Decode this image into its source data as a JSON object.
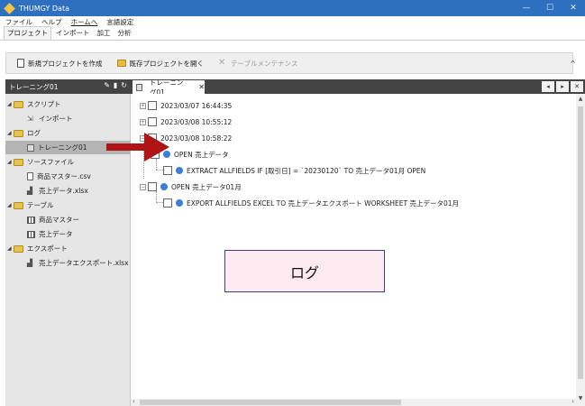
{
  "window": {
    "title": "THUMGY Data",
    "controls": [
      "—",
      "☐",
      "✕"
    ]
  },
  "menu": [
    "ファイル",
    "ヘルプ",
    "ホームへ",
    "言語設定"
  ],
  "ribbon_tabs": [
    "プロジェクト",
    "インポート",
    "加工",
    "分析"
  ],
  "toolbar": {
    "new_project": "新規プロジェクトを作成",
    "open_project": "既存プロジェクトを開く",
    "table_maint": "テーブルメンテナンス"
  },
  "left_panel": {
    "title": "トレーニング01",
    "items": [
      {
        "label": "スクリプト"
      },
      {
        "label": "インポート"
      },
      {
        "label": "ログ"
      },
      {
        "label": "トレーニング01"
      },
      {
        "label": "ソースファイル"
      },
      {
        "label": "商品マスター.csv"
      },
      {
        "label": "売上データ.xlsx"
      },
      {
        "label": "テーブル"
      },
      {
        "label": "商品マスター"
      },
      {
        "label": "売上データ"
      },
      {
        "label": "エクスポート"
      },
      {
        "label": "売上データエクスポート.xlsx"
      }
    ]
  },
  "tab": {
    "label": "トレーニング01"
  },
  "log": {
    "dates": [
      "2023/03/07 16:44:35",
      "2023/03/08 10:55:12",
      "2023/03/08 10:58:22"
    ],
    "entries": [
      "OPEN 売上データ",
      "EXTRACT ALLFIELDS IF [取引日] = `20230120` TO 売上データ01月 OPEN",
      "OPEN 売上データ01月",
      "EXPORT ALLFIELDS EXCEL TO 売上データエクスポート WORKSHEET 売上データ01月"
    ]
  },
  "callout": {
    "text": "ログ"
  },
  "colors": {
    "titlebar": "#2e6fbf",
    "panel_header": "#444444",
    "arrow": "#b01515",
    "callout_bg": "#fde9f0",
    "callout_border": "#3f3f8c",
    "dot": "#3b7ddd"
  }
}
